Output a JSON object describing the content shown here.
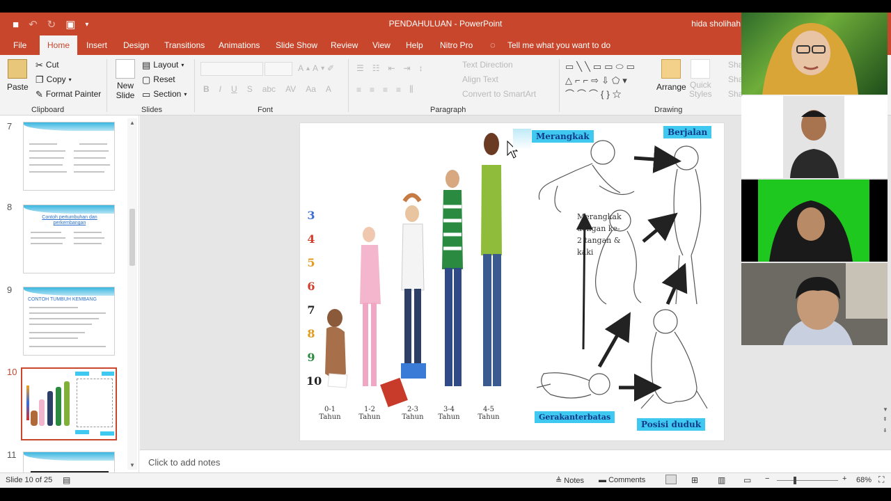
{
  "titlebar": {
    "doc_title": "PENDAHULUAN  -  PowerPoint",
    "user_name": "hida sholihah"
  },
  "tabs": [
    {
      "label": "File"
    },
    {
      "label": "Home"
    },
    {
      "label": "Insert"
    },
    {
      "label": "Design"
    },
    {
      "label": "Transitions"
    },
    {
      "label": "Animations"
    },
    {
      "label": "Slide Show"
    },
    {
      "label": "Review"
    },
    {
      "label": "View"
    },
    {
      "label": "Help"
    },
    {
      "label": "Nitro Pro"
    },
    {
      "label": "Tell me what you want to do"
    }
  ],
  "ribbon": {
    "clipboard": {
      "paste": "Paste",
      "cut": "Cut",
      "copy": "Copy",
      "format_painter": "Format Painter",
      "group": "Clipboard"
    },
    "slides": {
      "new_slide": "New",
      "new_slide2": "Slide",
      "layout": "Layout",
      "reset": "Reset",
      "section": "Section",
      "group": "Slides"
    },
    "font": {
      "group": "Font"
    },
    "paragraph": {
      "text_direction": "Text Direction",
      "align_text": "Align Text",
      "convert": "Convert to SmartArt",
      "group": "Paragraph"
    },
    "drawing": {
      "arrange": "Arrange",
      "quick": "Quick",
      "styles": "Styles",
      "group": "Drawing",
      "shape_fill_1": "Sha",
      "shape_fill_2": "Sha",
      "shape_fill_3": "Sha"
    }
  },
  "thumbnails": [
    {
      "num": "7"
    },
    {
      "num": "8",
      "title": "Contoh pertumbuhan dan perkembangan"
    },
    {
      "num": "9",
      "title": "CONTOH TUMBUH KEMBANG"
    },
    {
      "num": "10"
    },
    {
      "num": "11"
    }
  ],
  "slide": {
    "labels": {
      "merangkak": "Merangkak",
      "berjalan": "Berjalan",
      "gerak": "Gerakanterbatas",
      "posisi": "Posisi duduk",
      "crawl_note": "Merangkak dengan ke-2 tangan & kaki"
    },
    "numbers": [
      "3",
      "4",
      "5",
      "6",
      "7",
      "8",
      "9",
      "10"
    ],
    "ages": [
      {
        "a": "0-1",
        "b": "Tahun"
      },
      {
        "a": "1-2",
        "b": "Tahun"
      },
      {
        "a": "2-3",
        "b": "Tahun"
      },
      {
        "a": "3-4",
        "b": "Tahun"
      },
      {
        "a": "4-5",
        "b": "Tahun"
      }
    ]
  },
  "notes": {
    "placeholder": "Click to add notes"
  },
  "status": {
    "slide_counter": "Slide 10 of 25",
    "notes": "Notes",
    "comments": "Comments",
    "zoom": "68%"
  },
  "colors": {
    "accent": "#c8462b",
    "label_bg": "#3fc9f0"
  }
}
